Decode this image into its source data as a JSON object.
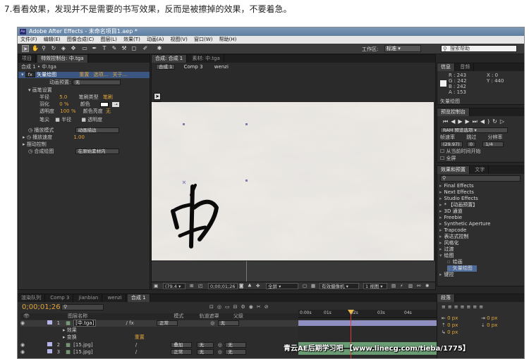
{
  "caption": "7.看看效果，发现并不是需要的书写效果，反而是被擦掉的效果，不要着急。",
  "window": {
    "title": "Adobe After Effects - 未命名项目1.aep *"
  },
  "menu": [
    "文件(F)",
    "编辑(E)",
    "图像合成(C)",
    "图层(L)",
    "效果(T)",
    "动画(A)",
    "视图(V)",
    "窗口(W)",
    "帮助(H)"
  ],
  "toolbar": {
    "workspace_label": "工作区:",
    "workspace_value": "标准",
    "search_placeholder": "搜索帮助"
  },
  "effect_controls": {
    "tabs": [
      "项目",
      "特效控制台: 中.tga"
    ],
    "breadcrumb": "合成 1 • 中.tga",
    "fx_name": "矢量绘图",
    "fx_reset": "重置",
    "fx_options": "选项...",
    "fx_about": "关于...",
    "preset_label": "动画预置:",
    "preset_value": "无",
    "brush_settings": "画笔设置",
    "radius_label": "半径",
    "radius_value": "5.0",
    "brush_type_label": "笔刷类型",
    "brush_type_value": "笔刷",
    "feather_label": "羽化",
    "feather_value": "0 %",
    "color_label": "颜色",
    "opacity_label": "透明度",
    "opacity_value": "100 %",
    "color_ratio_label": "颜色亮度",
    "color_ratio_value": "无",
    "pen_label": "笔尖",
    "pen_opt1": "半径",
    "pen_opt2": "透明度",
    "playback_mode_label": "播放模式",
    "playback_mode_value": "动画描边",
    "playback_speed_label": "播放速度",
    "playback_speed_value": "1.00",
    "wiggle_label": "摆动控制",
    "composite_label": "合成绘图",
    "composite_value": "在原始素材内"
  },
  "viewer": {
    "tabs": [
      "合成: 合成 1",
      "素材: 中.tga"
    ],
    "breadcrumbs": [
      "合成 1",
      "Comp 3",
      "wenzi"
    ],
    "zoom": "(79.4",
    "timecode": "0;00;01;26",
    "resolution": "全屏",
    "camera": "有效摄像机",
    "views": "1 视图"
  },
  "info": {
    "tabs": [
      "信息",
      "音频"
    ],
    "r": "R : 243",
    "g": "G : 242",
    "b": "B : 242",
    "a": "A : 153",
    "x": "X : 0",
    "y": "Y : 440",
    "layer": "矢量绘图"
  },
  "preview": {
    "tab": "预览控制台",
    "ram": "RAM 预览选项",
    "fps_label": "帧速率",
    "skip_label": "跳过",
    "res_label": "分辨率",
    "fps_value": "(29.97)",
    "skip_value": "0",
    "res_value": "1/4",
    "from_current": "从当前时间开始",
    "fullscreen": "全屏"
  },
  "effects_panel": {
    "tabs": [
      "效果和预置",
      "文字"
    ],
    "items": [
      "Final Effects",
      "Next Effects",
      "Studio Effects",
      "* 【动画预置】",
      "3D 通道",
      "Freebie",
      "Synthetic Aperture",
      "Trapcode",
      "表达式控制",
      "风格化",
      "过渡",
      "绘图",
      "绘画",
      "矢量绘图",
      "键控"
    ]
  },
  "paragraph": {
    "tab": "段落",
    "values": [
      "0 px",
      "0 px",
      "0 px",
      "0 px",
      "0 px"
    ]
  },
  "timeline": {
    "tabs": [
      "渲染队列",
      "Comp 3",
      "jianbian",
      "wenzi",
      "合成 1"
    ],
    "timecode": "0;00;01;26",
    "col_name": "图层名称",
    "col_mode": "模式",
    "col_trkmat": "轨道遮罩",
    "col_parent": "父级",
    "ruler": [
      "0:00s",
      "01s",
      "02s",
      "03s",
      "04s"
    ],
    "layers": [
      {
        "num": "1",
        "name": "[中.tga]",
        "mode": "正常",
        "trkmat": "",
        "parent": "无"
      },
      {
        "sub": "效果"
      },
      {
        "sub": "变换",
        "reset": "重置"
      },
      {
        "num": "2",
        "name": "[15.jpg]",
        "mode": "叠加",
        "trkmat": "无",
        "parent": "无"
      },
      {
        "num": "3",
        "name": "[15.jpg]",
        "mode": "正常",
        "trkmat": "无",
        "parent": "无"
      }
    ]
  },
  "watermark": "青云AE后期学习吧 【www.linecg.com/tieba/1775】",
  "colors": {
    "panel": "#2e2e2e",
    "accent": "#e3a53a",
    "title": "#6a88ab"
  }
}
